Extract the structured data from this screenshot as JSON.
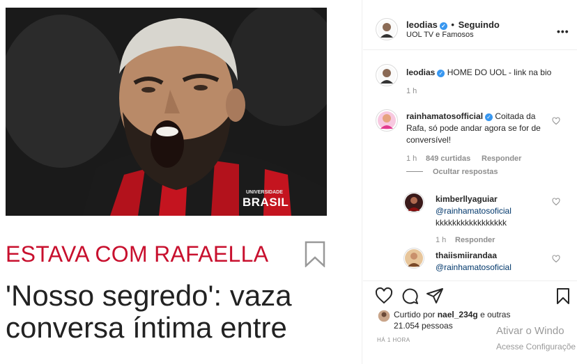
{
  "post": {
    "section_label": "ESTAVA COM RAFAELLA",
    "headline": "'Nosso segredo': vaza conversa íntima entre",
    "jersey_brand": "BRASIL",
    "jersey_small": "UNIVERSIDADE"
  },
  "header": {
    "username": "leodias",
    "dot": "•",
    "follow_status": "Seguindo",
    "subtitle": "UOL TV e Famosos",
    "more": "•••"
  },
  "caption": {
    "username": "leodias",
    "text": "HOME DO UOL - link na bio",
    "time": "1 h"
  },
  "comments": [
    {
      "username": "rainhamatosofficial",
      "text": "Coitada da Rafa, só pode andar agora se for de conversível!",
      "time": "1 h",
      "likes": "849 curtidas",
      "reply": "Responder",
      "hide_replies": "Ocultar respostas"
    }
  ],
  "replies": [
    {
      "username": "kimberllyaguiar",
      "mention": "@rainhamatosoficial",
      "text": "kkkkkkkkkkkkkkkkk",
      "time": "1 h",
      "reply": "Responder"
    },
    {
      "username": "thaiismiirandaa",
      "mention": "@rainhamatosoficial"
    }
  ],
  "actions": {
    "liked_by_prefix": "Curtido por",
    "liked_by_user": "nael_234g",
    "liked_by_suffix": "e outras 21.054 pessoas",
    "post_time": "HÁ 1 HORA"
  },
  "watermark": {
    "line1": "Ativar o Windo",
    "line2": "Acesse Configuraçõe"
  },
  "icons": [
    "verified-icon",
    "more-icon",
    "heart-icon",
    "comment-icon",
    "share-icon",
    "bookmark-icon"
  ],
  "colors": {
    "accent_red": "#c8102e",
    "verified_blue": "#3897f0",
    "muted": "#8e8e8e",
    "mention": "#00376b"
  }
}
